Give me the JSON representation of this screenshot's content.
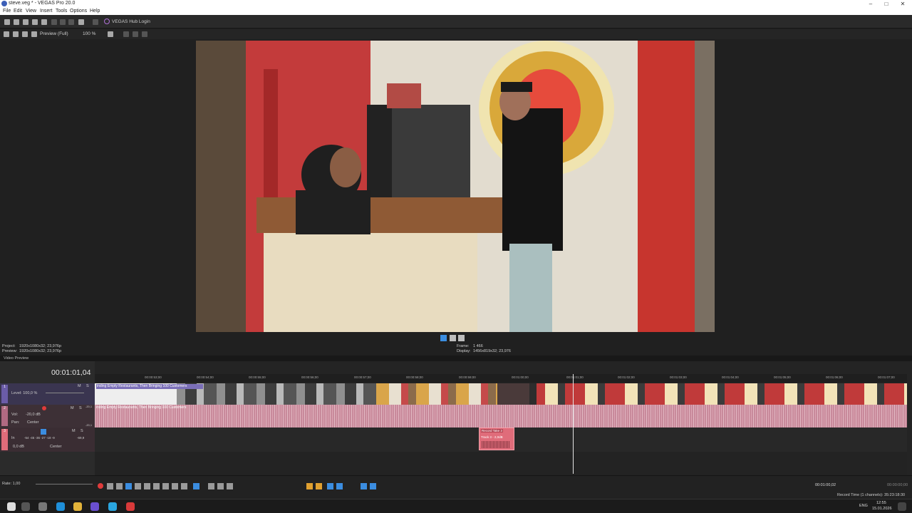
{
  "window": {
    "title": "steve.veg * - VEGAS Pro 20.0",
    "minimize": "–",
    "maximize": "□",
    "close": "✕"
  },
  "menu": [
    "File",
    "Edit",
    "View",
    "Insert",
    "Tools",
    "Options",
    "Help"
  ],
  "toolbar": {
    "hub_label": "VEGAS Hub Login"
  },
  "preview_toolbar": {
    "quality": "Preview (Full)",
    "zoom": "100 %"
  },
  "preview_info": {
    "project_label": "Project:",
    "project_value": "1920x1080x32; 23,976p",
    "preview_label": "Preview:",
    "preview_value": "1920x1080x32; 23,976p",
    "frame_label": "Frame:",
    "frame_value": "1 466",
    "display_label": "Display:",
    "display_value": "1456x819x32; 23,976",
    "tab": "Video Preview"
  },
  "timeline": {
    "timecode": "00:01:01,04",
    "ruler_labels": [
      "00:00:53;00",
      "00:00:54;00",
      "00:00:55;00",
      "00:00:56;00",
      "00:00:57;00",
      "00:00:58;00",
      "00:00:59;00",
      "00:01:00;00",
      "00:01:01;00",
      "00:01:02;00",
      "00:01:03;00",
      "00:01:04;00",
      "00:01:05;00",
      "00:01:06;00",
      "00:01:07;00"
    ],
    "video_track": {
      "index": "1",
      "level": "Level: 100,0 %",
      "m": "M",
      "s": "S",
      "clip_title": "inding Empty Restaurants, Then Bringing 100 Customers"
    },
    "audio_track": {
      "index": "2",
      "vol": "Vol:",
      "vol_value": "-20,0 dB",
      "pan": "Pan:",
      "pan_value": "Center",
      "m": "M",
      "s": "S",
      "clip_title": "inding Empty Restaurants, Then Bringing 100 Customers",
      "meter_top": "-20,1",
      "meter_bottom": "-20,1"
    },
    "record_track": {
      "index": "3",
      "in": "In",
      "gain": "0,0 dB",
      "pan_value": "Center",
      "m": "M",
      "s": "S",
      "meter_values": "-54  -45  -36  -27  -18  -9",
      "meter_top": "-69,9",
      "clip_title": "Record Take 3",
      "clip_label": "Track 3 - 2,0dB"
    }
  },
  "transport": {
    "rate": "Rate: 1,00",
    "time": "00:01:00,02",
    "end_time": "00:00:00;00",
    "record_time": "Record Time (1 channels): 35:23:18:30"
  },
  "taskbar": {
    "lang": "ENG",
    "clock_time": "12:55",
    "clock_date": "15.01.2026"
  },
  "colors": {
    "accent": "#3b8de0",
    "audio_wave": "#c88a9b",
    "record_clip": "#e06c7a"
  }
}
